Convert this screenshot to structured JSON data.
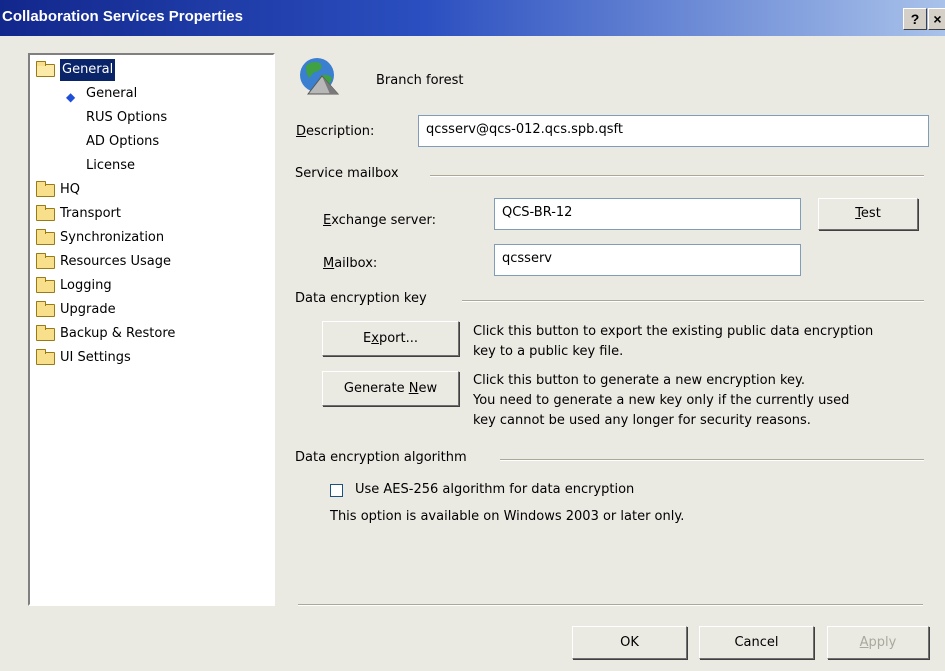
{
  "window": {
    "title": "Collaboration Services Properties",
    "help_label": "?",
    "close_label": "×"
  },
  "tree": {
    "items": [
      {
        "label": "General",
        "selected": true,
        "open": true
      },
      {
        "label": "General",
        "child": true,
        "current": true
      },
      {
        "label": "RUS Options",
        "child": true
      },
      {
        "label": "AD Options",
        "child": true
      },
      {
        "label": "License",
        "child": true
      },
      {
        "label": "HQ"
      },
      {
        "label": "Transport"
      },
      {
        "label": "Synchronization"
      },
      {
        "label": "Resources Usage"
      },
      {
        "label": "Logging"
      },
      {
        "label": "Upgrade"
      },
      {
        "label": "Backup & Restore"
      },
      {
        "label": "UI Settings"
      }
    ]
  },
  "header": {
    "name": "Branch forest",
    "icon": "globe-icon"
  },
  "description": {
    "label_underlined": "D",
    "label_rest": "escription:",
    "value": "qcsserv@qcs-012.qcs.spb.qsft"
  },
  "service_mailbox": {
    "heading": "Service mailbox",
    "exchange_label_underlined": "E",
    "exchange_label_rest": "xchange server:",
    "exchange_value": "QCS-BR-12",
    "test_underlined": "T",
    "test_rest": "est",
    "mailbox_label_underlined": "M",
    "mailbox_label_rest": "ailbox:",
    "mailbox_value": "qcsserv"
  },
  "encryption_key": {
    "heading": "Data encryption key",
    "export_pre": "E",
    "export_underlined": "x",
    "export_post": "port...",
    "export_desc_1": "Click this button to export the existing public data encryption",
    "export_desc_2": "key to a public key file.",
    "generate_pre": "Generate ",
    "generate_underlined": "N",
    "generate_post": "ew",
    "generate_desc_1": "Click this button to generate a new encryption key.",
    "generate_desc_2": "You need to generate a new key only if the currently used",
    "generate_desc_3": "key cannot be used any longer for security reasons."
  },
  "algorithm": {
    "heading": "Data encryption algorithm",
    "checkbox_label": "Use AES-256 algorithm for data encryption",
    "checked": false,
    "note": "This option is available on Windows 2003 or later only."
  },
  "footer": {
    "ok": "OK",
    "cancel": "Cancel",
    "apply_underlined": "A",
    "apply_rest": "pply"
  }
}
